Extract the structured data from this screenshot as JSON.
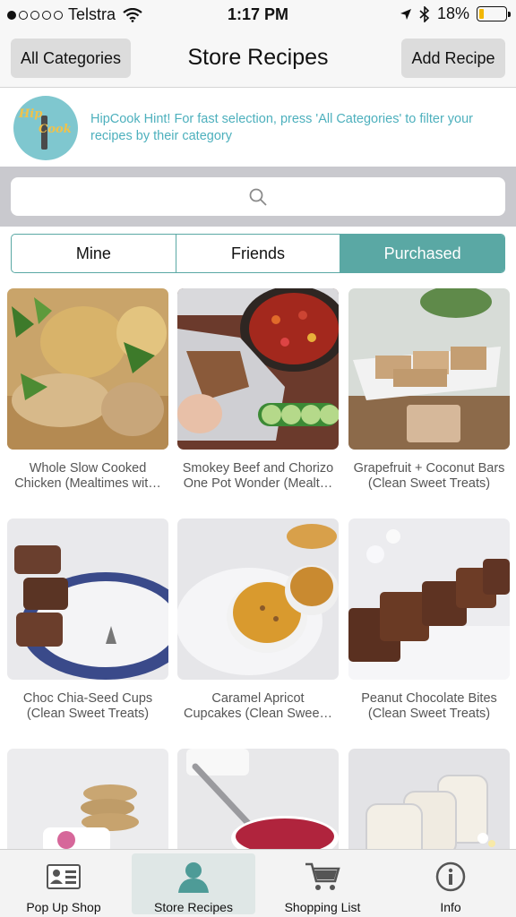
{
  "status": {
    "carrier": "Telstra",
    "time": "1:17 PM",
    "battery": "18%"
  },
  "nav": {
    "left_button": "All Categories",
    "title": "Store Recipes",
    "right_button": "Add Recipe"
  },
  "hint": {
    "logo_word1": "Hip",
    "logo_word2": "Cook",
    "text": "HipCook Hint! For fast selection, press 'All Categories' to filter your recipes by their category"
  },
  "search": {
    "placeholder": ""
  },
  "segments": [
    {
      "label": "Mine",
      "active": false
    },
    {
      "label": "Friends",
      "active": false
    },
    {
      "label": "Purchased",
      "active": true
    }
  ],
  "recipes": [
    {
      "line1": "Whole Slow Cooked",
      "line2": "Chicken (Mealtimes wit…"
    },
    {
      "line1": "Smokey Beef and Chorizo",
      "line2": "One Pot Wonder (Mealt…"
    },
    {
      "line1": "Grapefruit + Coconut Bars",
      "line2": "(Clean Sweet Treats)"
    },
    {
      "line1": "Choc Chia-Seed Cups",
      "line2": "(Clean Sweet Treats)"
    },
    {
      "line1": "Caramel Apricot",
      "line2": "Cupcakes (Clean Swee…"
    },
    {
      "line1": "Peanut Chocolate Bites",
      "line2": "(Clean Sweet Treats)"
    }
  ],
  "tabs": [
    {
      "label": "Pop Up Shop",
      "icon": "id-card-icon"
    },
    {
      "label": "Store Recipes",
      "icon": "person-icon",
      "active": true
    },
    {
      "label": "Shopping List",
      "icon": "cart-icon"
    },
    {
      "label": "Info",
      "icon": "info-icon"
    }
  ],
  "colors": {
    "accent": "#5aa8a4",
    "hint_text": "#4db0bd",
    "battery": "#f2b705"
  }
}
